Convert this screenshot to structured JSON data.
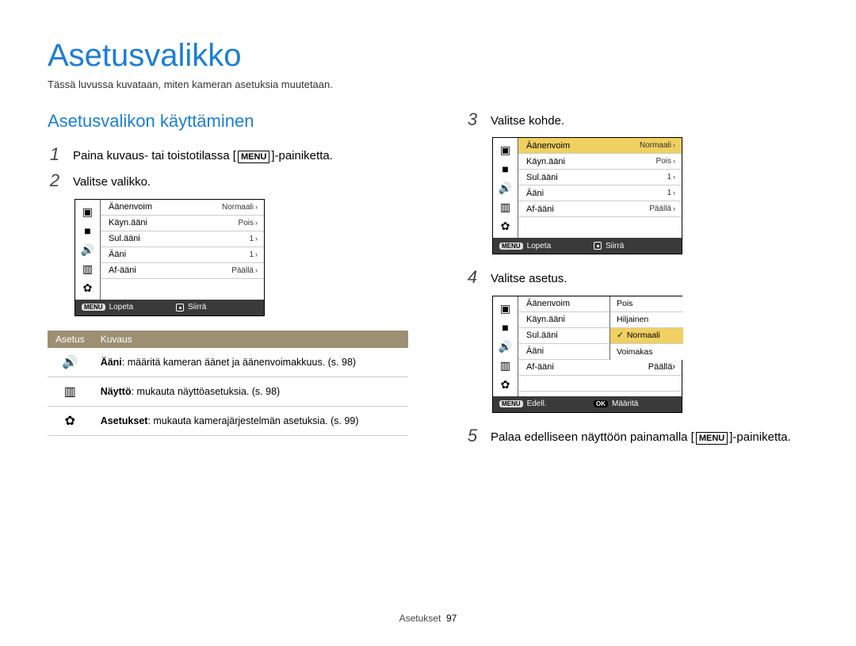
{
  "title": "Asetusvalikko",
  "subtitle": "Tässä luvussa kuvataan, miten kameran asetuksia muutetaan.",
  "section_heading": "Asetusvalikon käyttäminen",
  "menu_label": "MENU",
  "steps": {
    "s1_a": "Paina kuvaus- tai toistotilassa [",
    "s1_b": "]-painiketta.",
    "s2": "Valitse valikko.",
    "s3": "Valitse kohde.",
    "s4": "Valitse asetus.",
    "s5_a": "Palaa edelliseen näyttöön painamalla [",
    "s5_b": "]-painiketta."
  },
  "lcd_common": {
    "rows": {
      "volume": "Äänenvoim",
      "startup": "Käyn.ääni",
      "shutter": "Sul.ääni",
      "beep": "Ääni",
      "af": "Af-ääni"
    },
    "vals": {
      "normal": "Normaali",
      "off": "Pois",
      "one": "1",
      "on": "Päällä"
    },
    "foot": {
      "exit": "Lopeta",
      "move": "Siirrä",
      "back": "Edell.",
      "set": "Määritä",
      "menu": "MENU",
      "ok": "OK"
    }
  },
  "desc_table": {
    "h1": "Asetus",
    "h2": "Kuvaus",
    "r1_bold": "Ääni",
    "r1_rest": ": määritä kameran äänet ja äänenvoimakkuus. (s. 98)",
    "r2_bold": "Näyttö",
    "r2_rest": ": mukauta näyttöasetuksia. (s. 98)",
    "r3_bold": "Asetukset",
    "r3_rest": ": mukauta kamerajärjestelmän asetuksia. (s. 99)"
  },
  "options": {
    "off": "Pois",
    "quiet": "Hiljainen",
    "normal": "Normaali",
    "loud": "Voimakas"
  },
  "footer": {
    "section": "Asetukset",
    "page": "97"
  }
}
